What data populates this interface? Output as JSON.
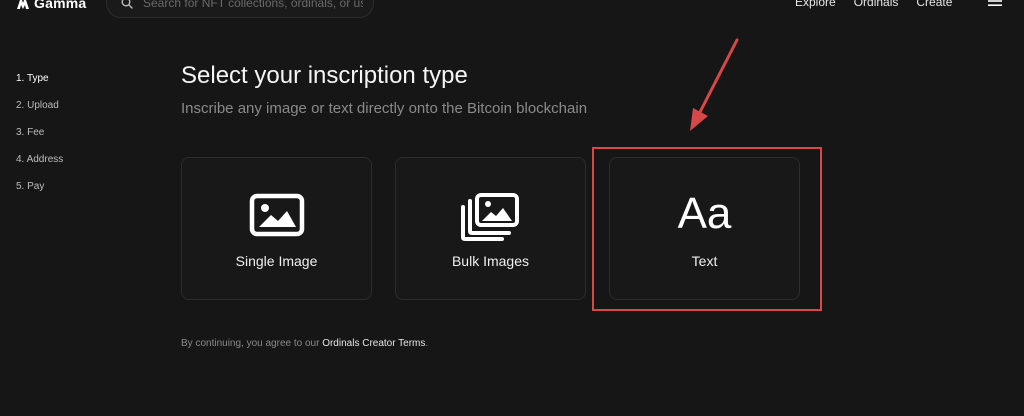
{
  "header": {
    "brand": "Gamma",
    "search_placeholder": "Search for NFT collections, ordinals, or users",
    "nav": [
      "Explore",
      "Ordinals",
      "Create"
    ]
  },
  "steps": [
    "1. Type",
    "2. Upload",
    "3. Fee",
    "4. Address",
    "5. Pay"
  ],
  "active_step": "1. Type",
  "main": {
    "title": "Select your inscription type",
    "subtitle": "Inscribe any image or text directly onto the Bitcoin blockchain",
    "cards": [
      {
        "label": "Single Image",
        "icon": "image-icon"
      },
      {
        "label": "Bulk Images",
        "icon": "images-stack-icon"
      },
      {
        "label": "Text",
        "icon": "text-aa-icon",
        "glyph": "Aa"
      }
    ],
    "terms_prefix": "By continuing, you agree to our ",
    "terms_link": "Ordinals Creator Terms",
    "terms_suffix": "."
  },
  "annotation": {
    "highlight_color": "#d94848",
    "highlighted_card": "Text"
  }
}
